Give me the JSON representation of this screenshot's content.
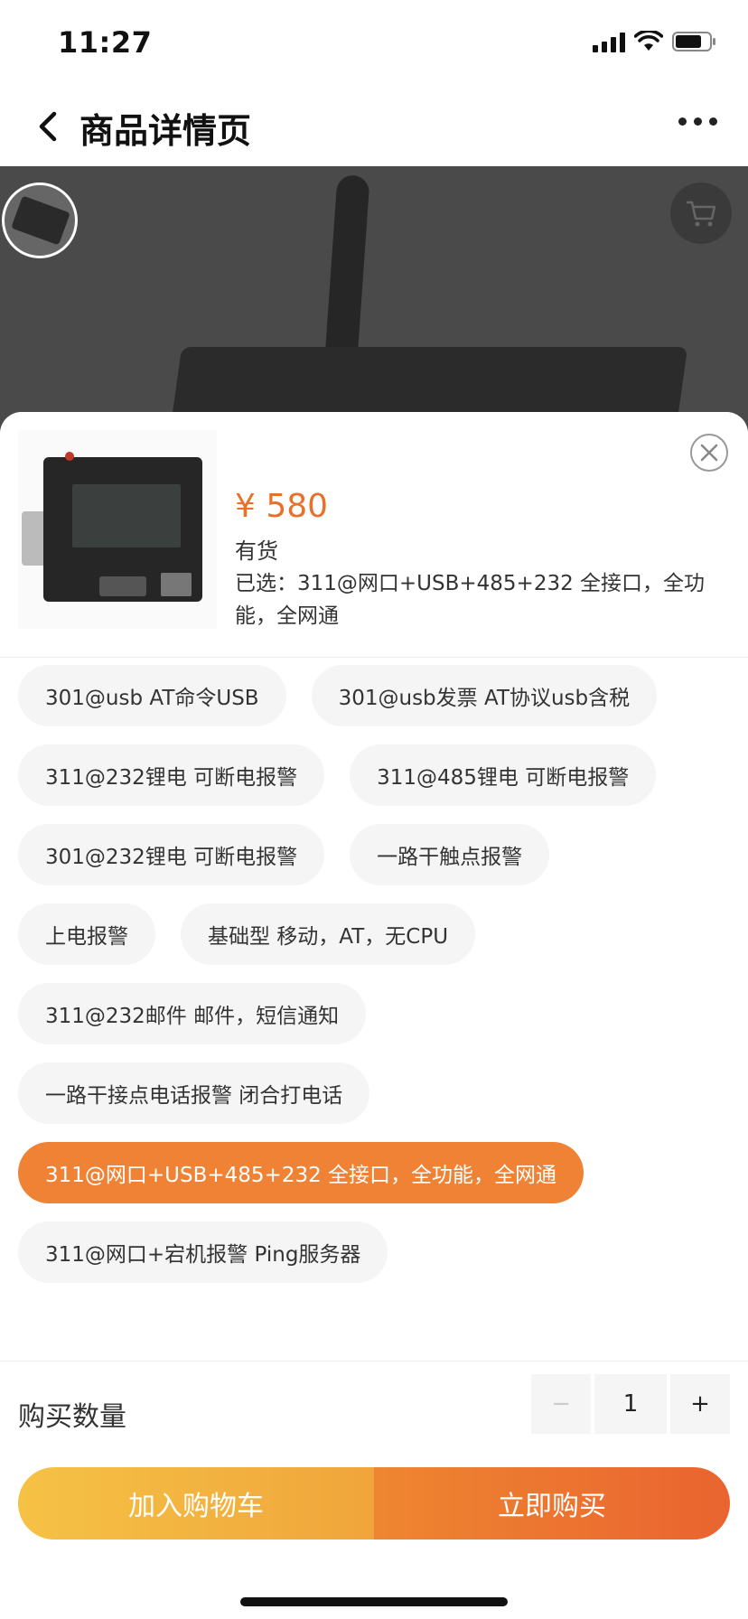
{
  "status_bar": {
    "time": "11:27"
  },
  "nav": {
    "title": "商品详情页"
  },
  "product": {
    "price": "¥ 580",
    "stock": "有货",
    "selected": "已选：311@网口+USB+485+232 全接口，全功能，全网通"
  },
  "options": [
    {
      "label": "301@usb AT命令USB",
      "active": false
    },
    {
      "label": "301@usb发票 AT协议usb含税",
      "active": false
    },
    {
      "label": "311@232锂电 可断电报警",
      "active": false
    },
    {
      "label": "311@485锂电 可断电报警",
      "active": false
    },
    {
      "label": "301@232锂电 可断电报警",
      "active": false
    },
    {
      "label": "一路干触点报警",
      "active": false
    },
    {
      "label": "上电报警",
      "active": false
    },
    {
      "label": "基础型 移动，AT，无CPU",
      "active": false
    },
    {
      "label": "311@232邮件 邮件，短信通知",
      "active": false
    },
    {
      "label": "一路干接点电话报警 闭合打电话",
      "active": false
    },
    {
      "label": "311@网口+USB+485+232 全接口，全功能，全网通",
      "active": true
    },
    {
      "label": "311@网口+宕机报警 Ping服务器",
      "active": false
    }
  ],
  "quantity": {
    "label": "购买数量",
    "value": "1",
    "minus": "−",
    "plus": "+"
  },
  "actions": {
    "add_to_cart": "加入购物车",
    "buy_now": "立即购买"
  },
  "colors": {
    "accent": "#ef8234",
    "price": "#e8702a",
    "cart_gradient_start": "#f5c245",
    "buy_gradient_end": "#ea6430"
  }
}
